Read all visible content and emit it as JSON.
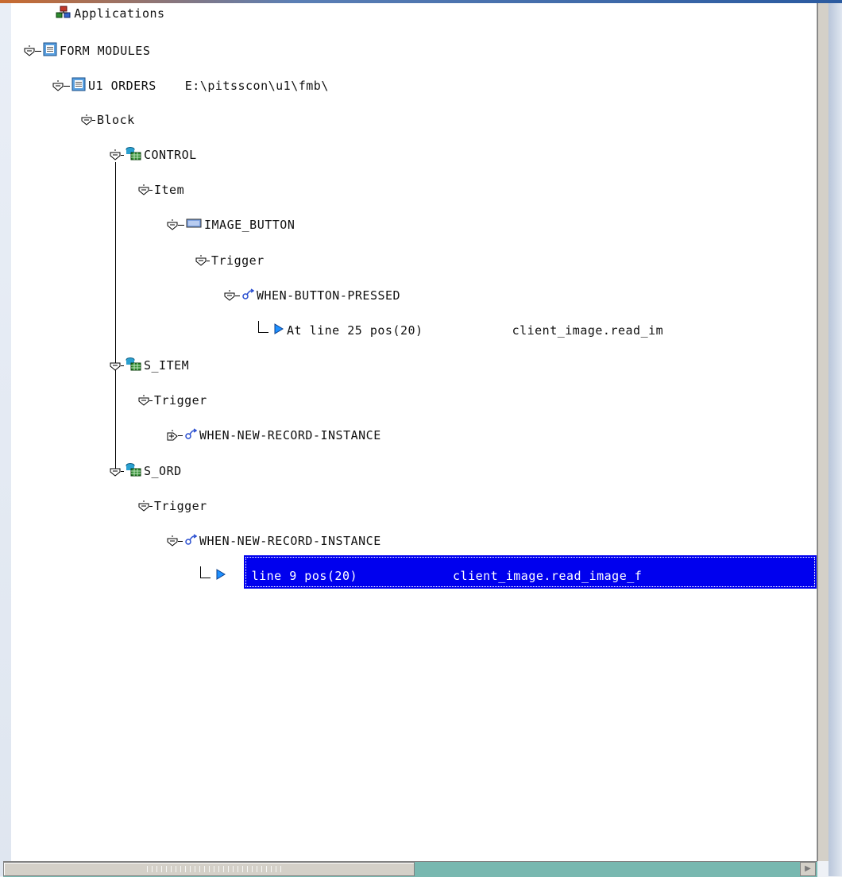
{
  "tree": {
    "root": "Applications",
    "form_modules": "FORM MODULES",
    "module": {
      "name": "U1 ORDERS",
      "path": "E:\\pitsscon\\u1\\fmb\\"
    },
    "block": "Block",
    "control": "CONTROL",
    "control_item": "Item",
    "image_button": "IMAGE_BUTTON",
    "image_button_trigger": "Trigger",
    "when_button_pressed": "WHEN-BUTTON-PRESSED",
    "hit1": {
      "location": "At line 25 pos(20)",
      "code": "client_image.read_im"
    },
    "s_item": "S_ITEM",
    "s_item_trigger": "Trigger",
    "s_item_when_new": "WHEN-NEW-RECORD-INSTANCE",
    "s_ord": "S_ORD",
    "s_ord_trigger": "Trigger",
    "s_ord_when_new": "WHEN-NEW-RECORD-INSTANCE",
    "hit2": {
      "location": "At line 9 pos(20)",
      "code": "client_image.read_image_f"
    }
  },
  "icons": {
    "applications": "applications-icon",
    "form_module": "form-module-icon",
    "block": "block-table-icon",
    "button_item": "button-item-icon",
    "trigger": "trigger-icon",
    "search_hit": "play-arrow-icon"
  },
  "colors": {
    "selection": "#0000ee",
    "scrollbar_track": "#78b8b0"
  }
}
